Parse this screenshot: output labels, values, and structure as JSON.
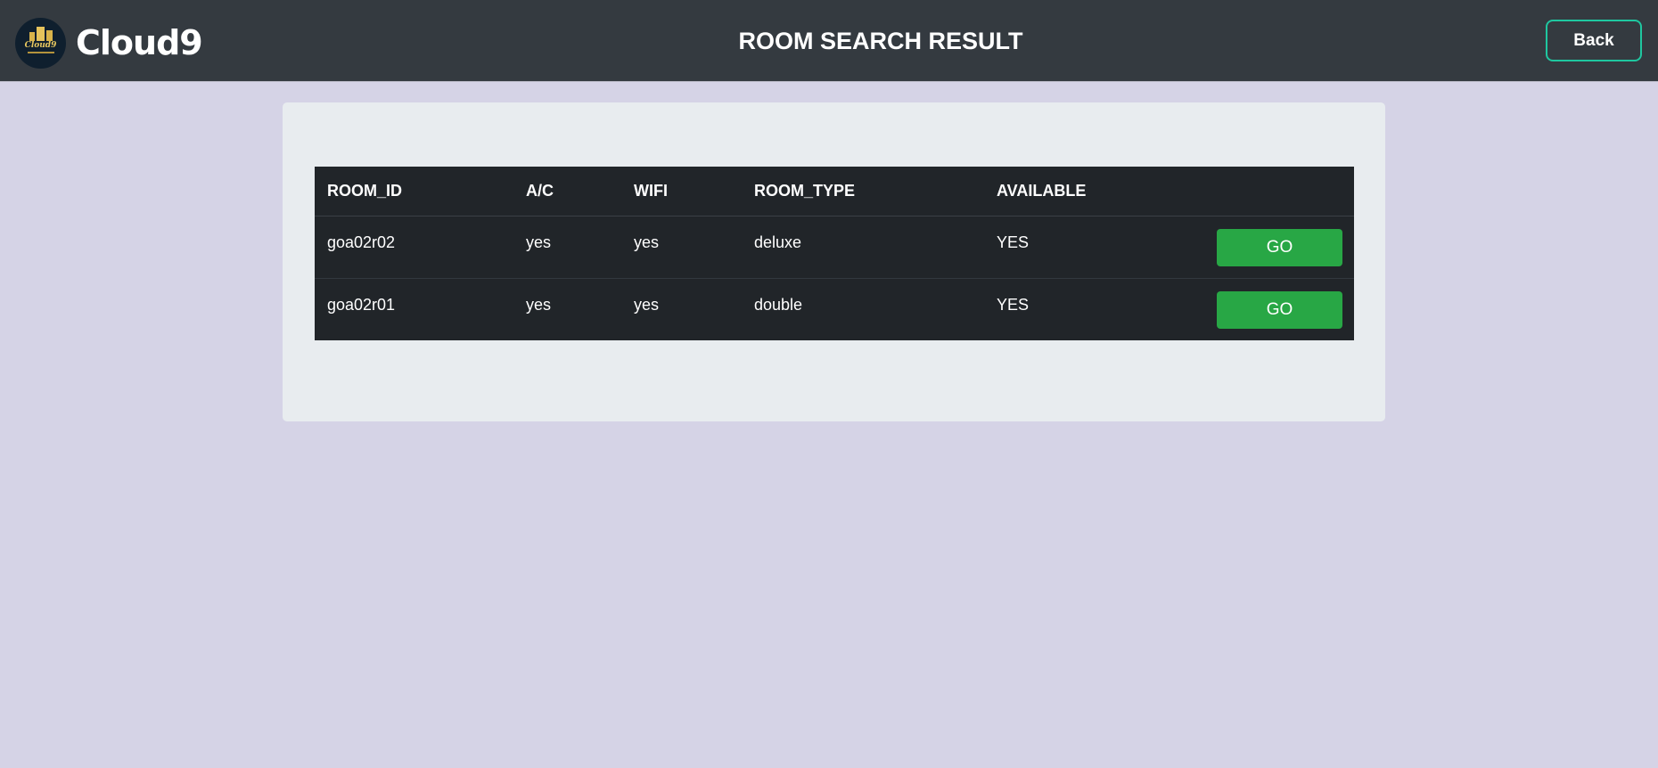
{
  "header": {
    "brand_name": "Cloud9",
    "logo_text": "Cloud9",
    "title": "ROOM SEARCH RESULT",
    "back_label": "Back"
  },
  "table": {
    "columns": [
      "ROOM_ID",
      "A/C",
      "WIFI",
      "ROOM_TYPE",
      "AVAILABLE",
      ""
    ],
    "rows": [
      {
        "room_id": "goa02r02",
        "ac": "yes",
        "wifi": "yes",
        "room_type": "deluxe",
        "available": "YES",
        "action": "GO"
      },
      {
        "room_id": "goa02r01",
        "ac": "yes",
        "wifi": "yes",
        "room_type": "double",
        "available": "YES",
        "action": "GO"
      }
    ]
  },
  "colors": {
    "navbar": "#343a40",
    "page_background": "#d5d3e6",
    "panel": "#e8ecef",
    "table": "#212529",
    "go_button": "#28a745",
    "back_border": "#1fc7a0"
  }
}
